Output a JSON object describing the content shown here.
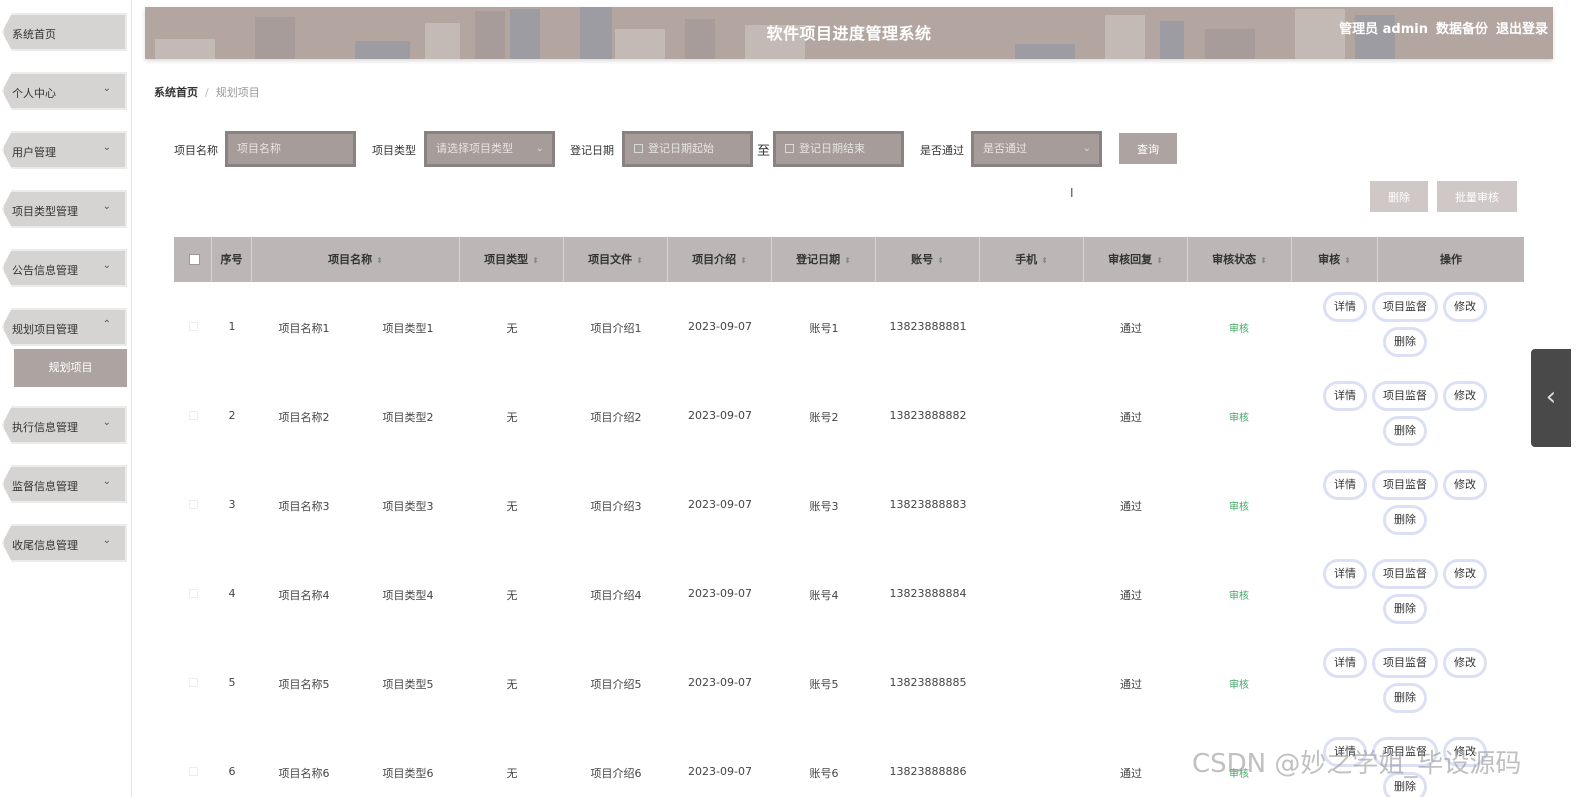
{
  "app": {
    "title": "软件项目进度管理系统",
    "user_label": "管理员 admin",
    "backup_label": "数据备份",
    "logout_label": "退出登录"
  },
  "sidebar": {
    "items": [
      {
        "label": "系统首页",
        "chevron": ""
      },
      {
        "label": "个人中心",
        "chevron": "⌄"
      },
      {
        "label": "用户管理",
        "chevron": "⌄"
      },
      {
        "label": "项目类型管理",
        "chevron": "⌄"
      },
      {
        "label": "公告信息管理",
        "chevron": "⌄"
      },
      {
        "label": "规划项目管理",
        "chevron": "⌃"
      },
      {
        "label": "执行信息管理",
        "chevron": "⌄"
      },
      {
        "label": "监督信息管理",
        "chevron": "⌄"
      },
      {
        "label": "收尾信息管理",
        "chevron": "⌄"
      }
    ],
    "active_sub": "规划项目"
  },
  "breadcrumb": {
    "home": "系统首页",
    "separator": "/",
    "current": "规划项目"
  },
  "search": {
    "name_label": "项目名称",
    "name_placeholder": "项目名称",
    "type_label": "项目类型",
    "type_placeholder": "请选择项目类型",
    "date_label": "登记日期",
    "date_start_placeholder": "登记日期起始",
    "date_to": "至",
    "date_end_placeholder": "登记日期结束",
    "pass_label": "是否通过",
    "pass_placeholder": "是否通过",
    "query_button": "查询"
  },
  "actions": {
    "delete": "删除",
    "batch_audit": "批量审核"
  },
  "table": {
    "headers": [
      "序号",
      "项目名称",
      "项目类型",
      "项目文件",
      "项目介绍",
      "登记日期",
      "账号",
      "手机",
      "审核回复",
      "审核状态",
      "审核",
      "操作"
    ],
    "rows": [
      {
        "index": "1",
        "name": "项目名称1",
        "type": "项目类型1",
        "file": "无",
        "intro": "项目介绍1",
        "date": "2023-09-07",
        "account": "账号1",
        "phone": "13823888881",
        "reply": "",
        "status": "通过",
        "audit": "审核"
      },
      {
        "index": "2",
        "name": "项目名称2",
        "type": "项目类型2",
        "file": "无",
        "intro": "项目介绍2",
        "date": "2023-09-07",
        "account": "账号2",
        "phone": "13823888882",
        "reply": "",
        "status": "通过",
        "audit": "审核"
      },
      {
        "index": "3",
        "name": "项目名称3",
        "type": "项目类型3",
        "file": "无",
        "intro": "项目介绍3",
        "date": "2023-09-07",
        "account": "账号3",
        "phone": "13823888883",
        "reply": "",
        "status": "通过",
        "audit": "审核"
      },
      {
        "index": "4",
        "name": "项目名称4",
        "type": "项目类型4",
        "file": "无",
        "intro": "项目介绍4",
        "date": "2023-09-07",
        "account": "账号4",
        "phone": "13823888884",
        "reply": "",
        "status": "通过",
        "audit": "审核"
      },
      {
        "index": "5",
        "name": "项目名称5",
        "type": "项目类型5",
        "file": "无",
        "intro": "项目介绍5",
        "date": "2023-09-07",
        "account": "账号5",
        "phone": "13823888885",
        "reply": "",
        "status": "通过",
        "audit": "审核"
      },
      {
        "index": "6",
        "name": "项目名称6",
        "type": "项目类型6",
        "file": "无",
        "intro": "项目介绍6",
        "date": "2023-09-07",
        "account": "账号6",
        "phone": "13823888886",
        "reply": "",
        "status": "通过",
        "audit": "审核"
      }
    ],
    "row_buttons": {
      "detail": "详情",
      "supervise": "项目监督",
      "edit": "修改",
      "delete": "删除"
    },
    "sort_glyph": "⬍"
  },
  "icons": {
    "toggle": "chevron-left-icon",
    "toggle_glyph": "‹",
    "cursor_glyph": "I"
  },
  "watermark": "CSDN @妙之学姐_毕设源码",
  "colors": {
    "header_bg": "#b3a5a0",
    "accent": "#ada3a0",
    "audit_green": "#3fa866",
    "pill_border": "#dbe0f5"
  }
}
